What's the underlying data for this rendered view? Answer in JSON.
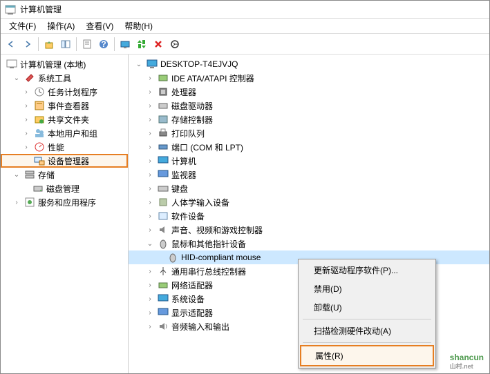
{
  "title": "计算机管理",
  "menu": {
    "file": "文件(F)",
    "action": "操作(A)",
    "view": "查看(V)",
    "help": "帮助(H)"
  },
  "left": {
    "root": "计算机管理 (本地)",
    "systools": "系统工具",
    "taskscheduler": "任务计划程序",
    "eventviewer": "事件查看器",
    "sharedfolders": "共享文件夹",
    "localusers": "本地用户和组",
    "performance": "性能",
    "devicemanager": "设备管理器",
    "storage": "存储",
    "diskmgmt": "磁盘管理",
    "services": "服务和应用程序"
  },
  "right": {
    "computer": "DESKTOP-T4EJVJQ",
    "ide": "IDE ATA/ATAPI 控制器",
    "processor": "处理器",
    "diskdrive": "磁盘驱动器",
    "storagectl": "存储控制器",
    "printqueue": "打印队列",
    "ports": "端口 (COM 和 LPT)",
    "computers": "计算机",
    "monitors": "监视器",
    "keyboards": "键盘",
    "hid": "人体学输入设备",
    "software": "软件设备",
    "sound": "声音、视频和游戏控制器",
    "mice": "鼠标和其他指针设备",
    "hidmouse": "HID-compliant mouse",
    "usb": "通用串行总线控制器",
    "network": "网络适配器",
    "system": "系统设备",
    "display": "显示适配器",
    "audio": "音频输入和输出"
  },
  "contextmenu": {
    "updatedriver": "更新驱动程序软件(P)...",
    "disable": "禁用(D)",
    "uninstall": "卸载(U)",
    "scanhw": "扫描检测硬件改动(A)",
    "properties": "属性(R)"
  },
  "watermark": {
    "main": "shancun",
    "sub": "山村.net"
  }
}
